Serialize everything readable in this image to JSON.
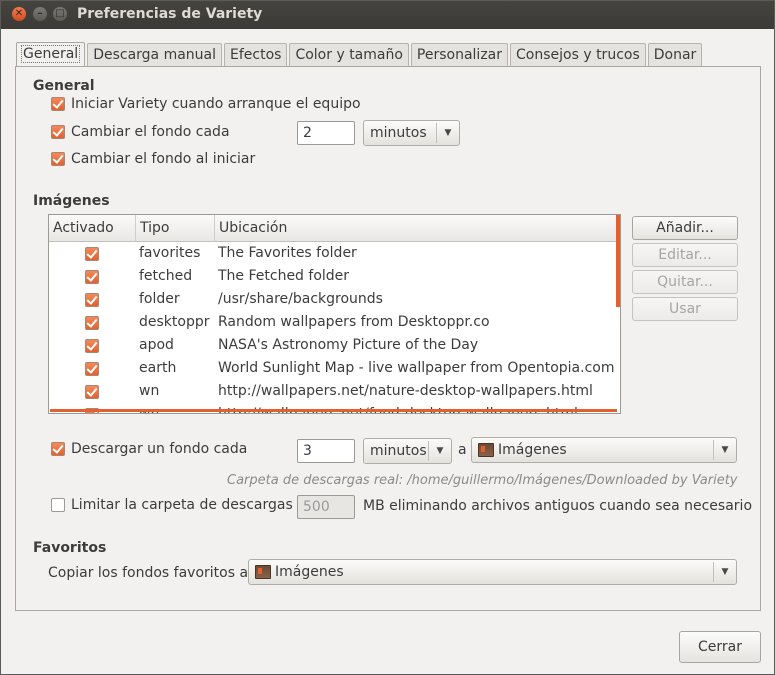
{
  "window": {
    "title": "Preferencias de Variety"
  },
  "tabs": [
    "General",
    "Descarga manual",
    "Efectos",
    "Color y tamaño",
    "Personalizar",
    "Consejos y trucos",
    "Donar"
  ],
  "general": {
    "heading": "General",
    "start_on_boot": {
      "label": "Iniciar Variety cuando arranque el equipo",
      "checked": true
    },
    "change_every": {
      "label": "Cambiar el fondo cada",
      "checked": true,
      "value": "2",
      "unit": "minutos"
    },
    "change_on_start": {
      "label": "Cambiar el fondo al iniciar",
      "checked": true
    }
  },
  "images": {
    "heading": "Imágenes",
    "columns": [
      "Activado",
      "Tipo",
      "Ubicación"
    ],
    "rows": [
      {
        "type": "favorites",
        "location": "The Favorites folder"
      },
      {
        "type": "fetched",
        "location": "The Fetched folder"
      },
      {
        "type": "folder",
        "location": "/usr/share/backgrounds"
      },
      {
        "type": "desktoppr",
        "location": "Random wallpapers from Desktoppr.co"
      },
      {
        "type": "apod",
        "location": "NASA's Astronomy Picture of the Day"
      },
      {
        "type": "earth",
        "location": "World Sunlight Map - live wallpaper from Opentopia.com"
      },
      {
        "type": "wn",
        "location": "http://wallpapers.net/nature-desktop-wallpapers.html"
      },
      {
        "type": "wn",
        "location": "http://wallpapers.net/food-desktop-wallpapers.html"
      }
    ],
    "buttons": {
      "add": "Añadir...",
      "edit": "Editar...",
      "remove": "Quitar...",
      "use": "Usar"
    }
  },
  "download": {
    "label": "Descargar un fondo cada",
    "checked": true,
    "value": "3",
    "unit": "minutos",
    "to_label": "a",
    "folder": "Imágenes",
    "real_folder_note": "Carpeta de descargas real: /home/guillermo/Imágenes/Downloaded by Variety",
    "limit_label": "Limitar la carpeta de descargas a",
    "limit_checked": false,
    "limit_value": "500",
    "limit_suffix": "MB eliminando archivos antiguos cuando sea necesario"
  },
  "favorites": {
    "heading": "Favoritos",
    "copy_label": "Copiar los fondos favoritos a",
    "folder": "Imágenes"
  },
  "footer": {
    "close": "Cerrar"
  },
  "colors": {
    "accent": "#e2612f",
    "titlebar": "#3c3b37"
  }
}
